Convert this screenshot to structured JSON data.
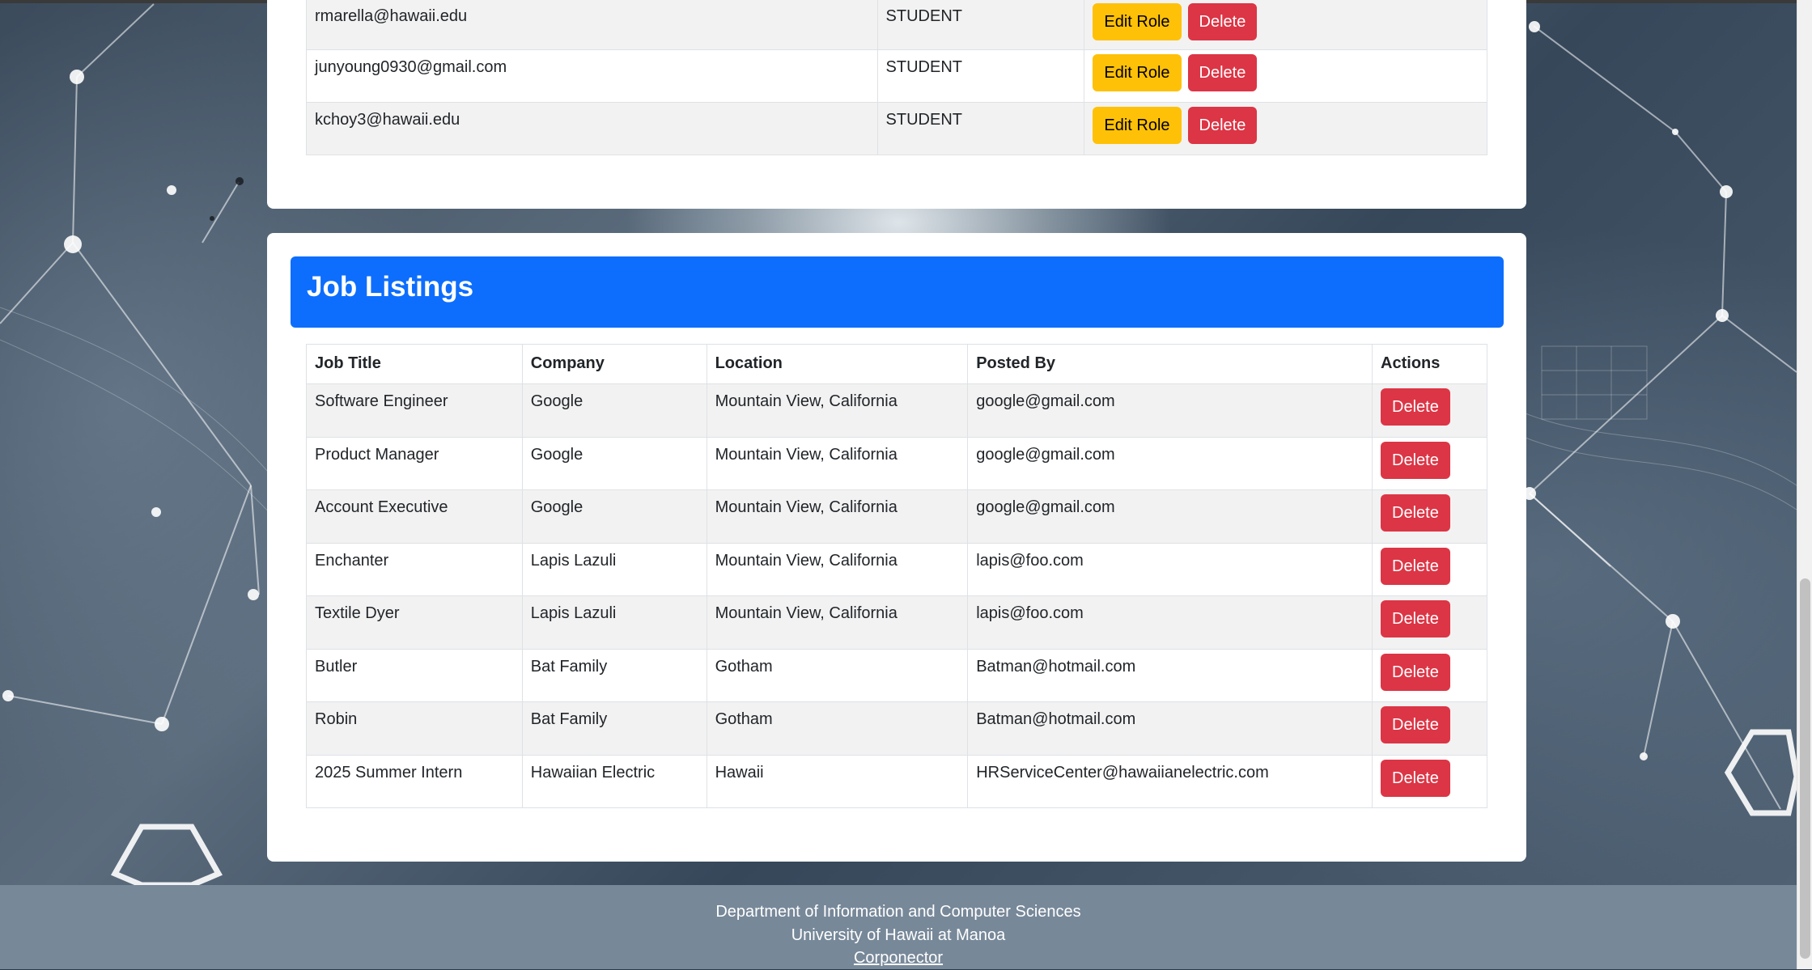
{
  "users": {
    "rows": [
      {
        "email": "rmarella@hawaii.edu",
        "role": "STUDENT"
      },
      {
        "email": "junyoung0930@gmail.com",
        "role": "STUDENT"
      },
      {
        "email": "kchoy3@hawaii.edu",
        "role": "STUDENT"
      }
    ],
    "edit_label": "Edit Role",
    "delete_label": "Delete"
  },
  "jobs": {
    "title": "Job Listings",
    "columns": [
      "Job Title",
      "Company",
      "Location",
      "Posted By",
      "Actions"
    ],
    "delete_label": "Delete",
    "rows": [
      {
        "title": "Software Engineer",
        "company": "Google",
        "location": "Mountain View, California",
        "posted_by": "google@gmail.com"
      },
      {
        "title": "Product Manager",
        "company": "Google",
        "location": "Mountain View, California",
        "posted_by": "google@gmail.com"
      },
      {
        "title": "Account Executive",
        "company": "Google",
        "location": "Mountain View, California",
        "posted_by": "google@gmail.com"
      },
      {
        "title": "Enchanter",
        "company": "Lapis Lazuli",
        "location": "Mountain View, California",
        "posted_by": "lapis@foo.com"
      },
      {
        "title": "Textile Dyer",
        "company": "Lapis Lazuli",
        "location": "Mountain View, California",
        "posted_by": "lapis@foo.com"
      },
      {
        "title": "Butler",
        "company": "Bat Family",
        "location": "Gotham",
        "posted_by": "Batman@hotmail.com"
      },
      {
        "title": "Robin",
        "company": "Bat Family",
        "location": "Gotham",
        "posted_by": "Batman@hotmail.com"
      },
      {
        "title": "2025 Summer Intern",
        "company": "Hawaiian Electric",
        "location": "Hawaii",
        "posted_by": "HRServiceCenter@hawaiianelectric.com"
      }
    ]
  },
  "footer": {
    "line1": "Department of Information and Computer Sciences",
    "line2": "University of Hawaii at Manoa",
    "link": "Corponector"
  },
  "colors": {
    "primary": "#0d6efd",
    "warning": "#ffc107",
    "danger": "#dc3545",
    "footer": "#778899"
  }
}
